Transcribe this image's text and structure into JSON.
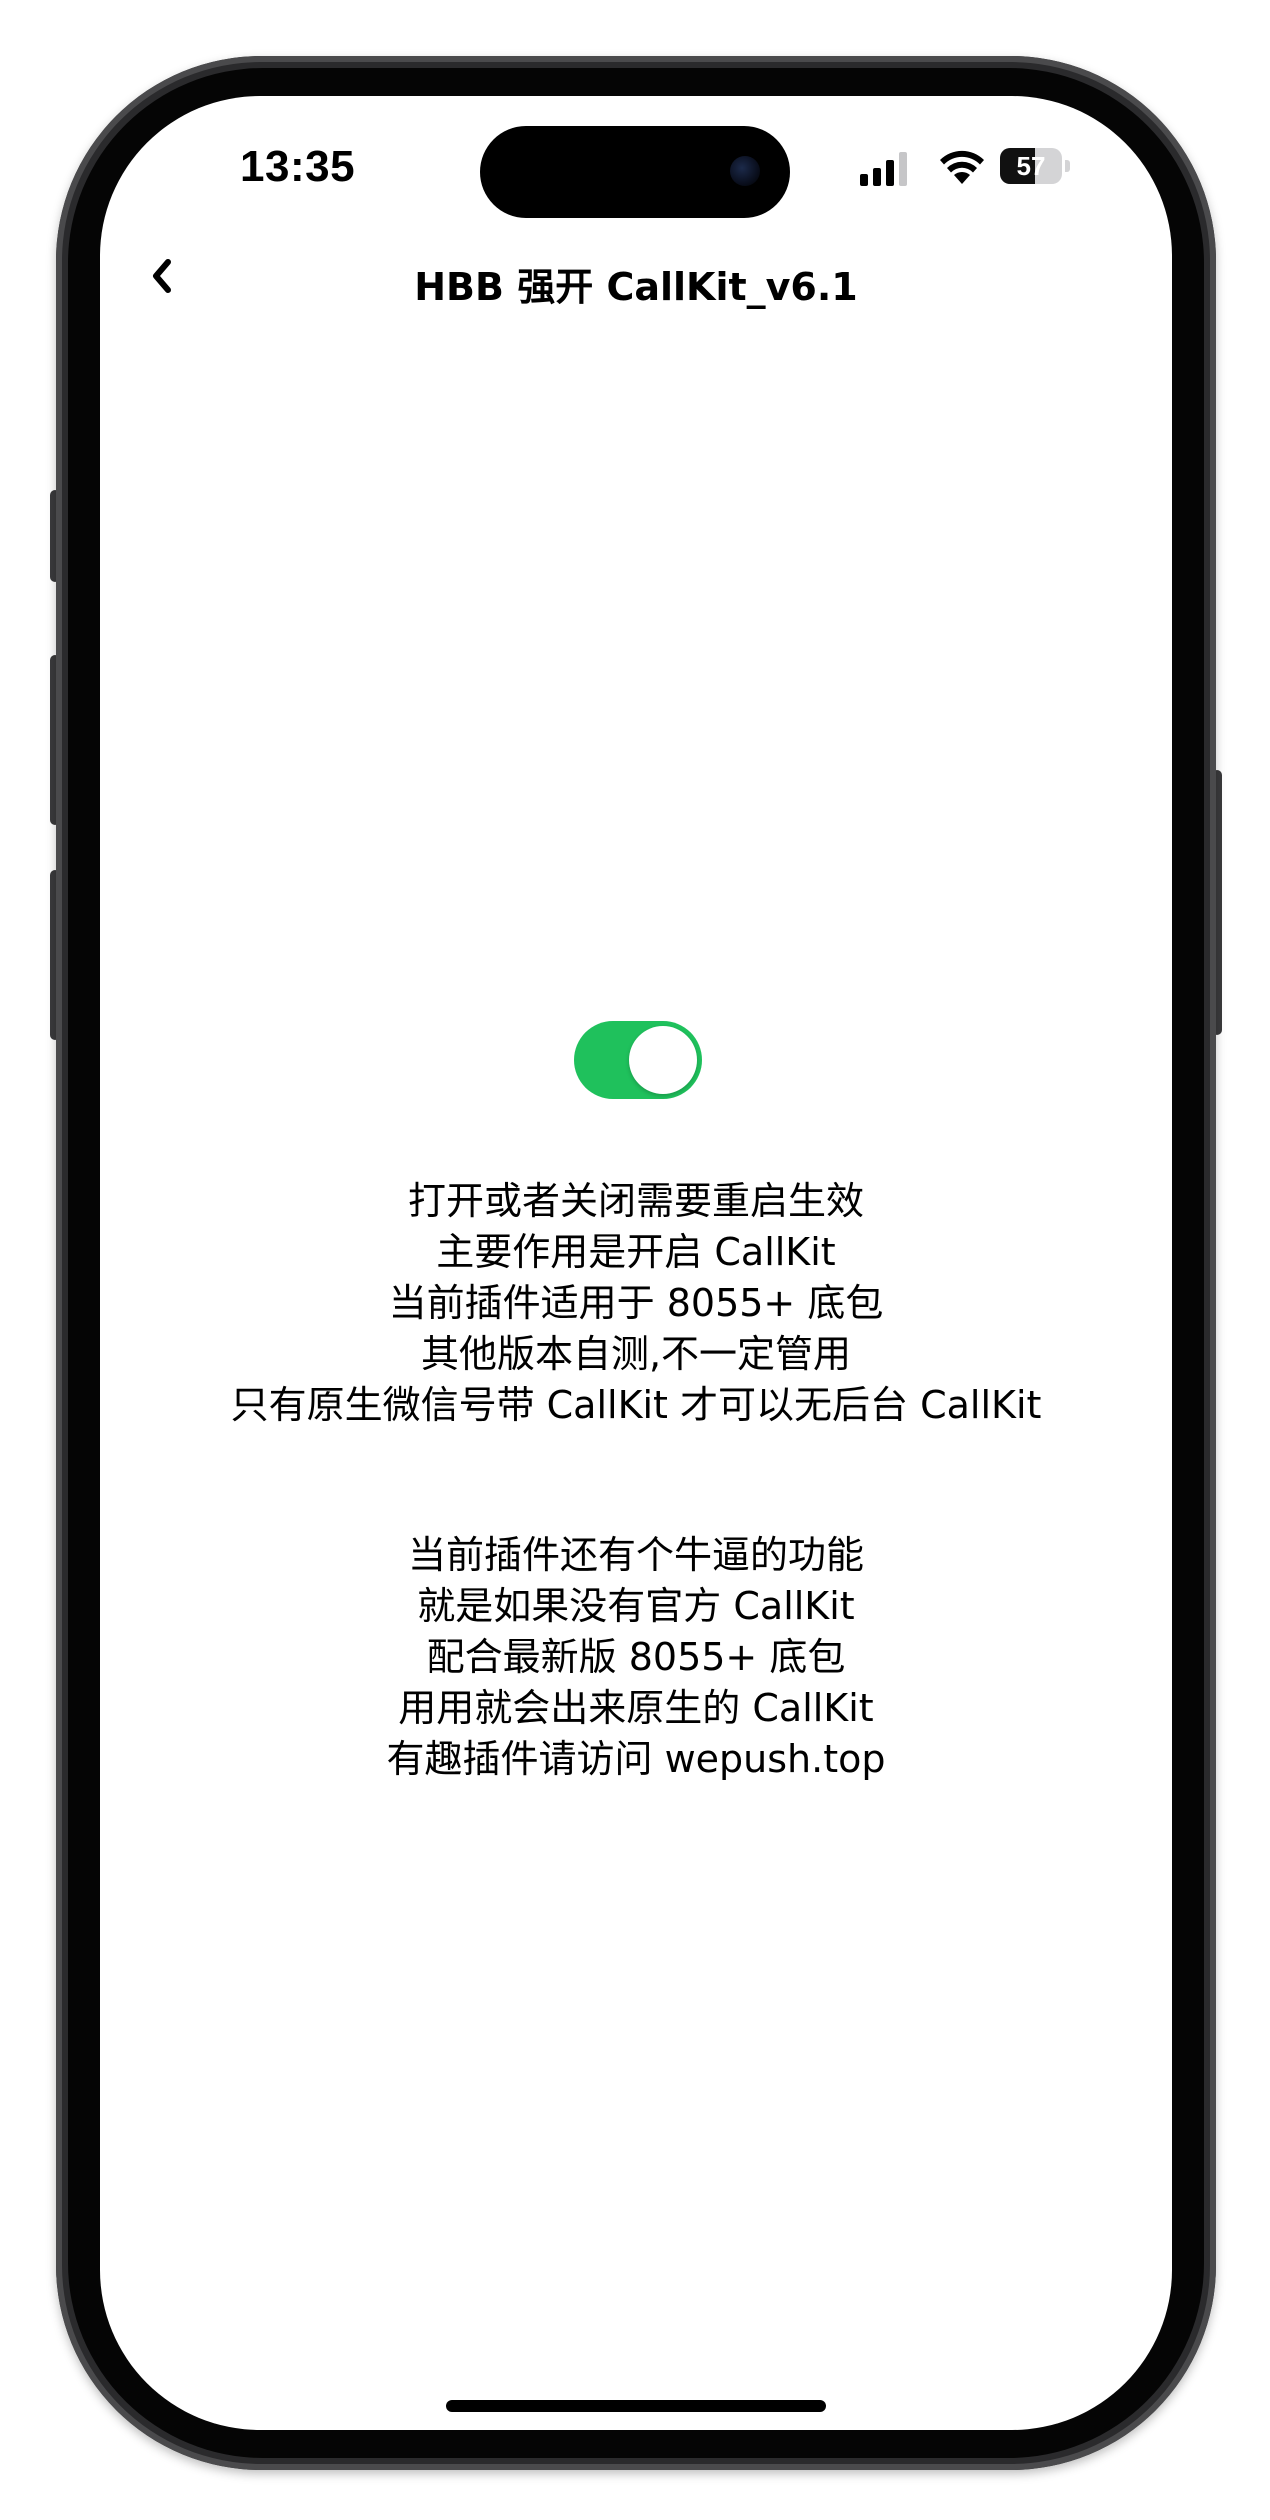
{
  "status_bar": {
    "time": "13:35",
    "battery_level": "57",
    "battery_percent": 57
  },
  "nav": {
    "title": "HBB 强开 CallKit_v6.1"
  },
  "toggle": {
    "state": "on",
    "color": "#1fc15c"
  },
  "info_group_1": {
    "lines": [
      "打开或者关闭需要重启生效",
      "主要作用是开启 CallKit",
      "当前插件适用于 8055+ 底包",
      "其他版本自测,不一定管用",
      "只有原生微信号带 CallKit 才可以无后台 CallKit"
    ]
  },
  "info_group_2": {
    "lines": [
      "当前插件还有个牛逼的功能",
      "就是如果没有官方 CallKit",
      "配合最新版 8055+ 底包",
      "用用就会出来原生的 CallKit",
      "有趣插件请访问 wepush.top"
    ]
  }
}
